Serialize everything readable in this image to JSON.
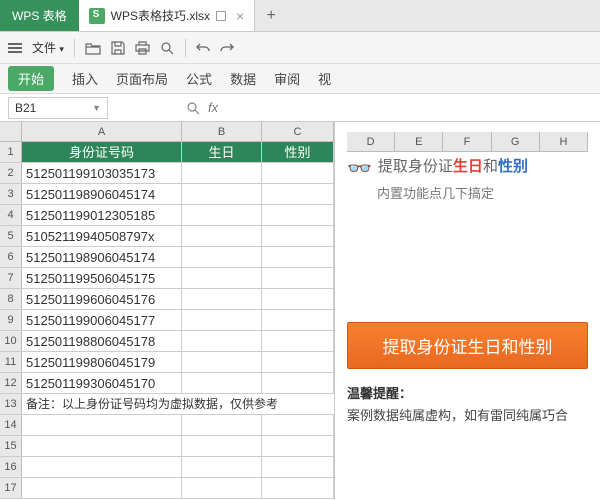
{
  "titlebar": {
    "app_name": "WPS 表格",
    "file_name": "WPS表格技巧.xlsx",
    "new_tab": "+"
  },
  "toolbar": {
    "file_menu": "文件"
  },
  "ribbon": {
    "start": "开始",
    "items": [
      "插入",
      "页面布局",
      "公式",
      "数据",
      "审阅",
      "视"
    ]
  },
  "formula": {
    "name_box": "B21",
    "fx": "fx"
  },
  "columns": [
    "A",
    "B",
    "C"
  ],
  "ext_columns": [
    "D",
    "E",
    "F",
    "G",
    "H"
  ],
  "headers": {
    "a": "身份证号码",
    "b": "生日",
    "c": "性别"
  },
  "rows": [
    "512501199103035173",
    "512501198906045174",
    "512501199012305185",
    "51052119940508797x",
    "512501198906045174",
    "512501199506045175",
    "512501199606045176",
    "512501199006045177",
    "512501198806045178",
    "512501199806045179",
    "512501199306045170"
  ],
  "note": "备注：以上身份证号码均为虚拟数据，仅供参考",
  "row_nums": [
    "1",
    "2",
    "3",
    "4",
    "5",
    "6",
    "7",
    "8",
    "9",
    "10",
    "11",
    "12",
    "13",
    "14",
    "15",
    "16",
    "17"
  ],
  "tip": {
    "t1": "提取身份证",
    "t2": "生日",
    "t3": "和",
    "t4": "性别",
    "sub": "内置功能点几下搞定"
  },
  "button": "提取身份证生日和性别",
  "warm": {
    "title": "温馨提醒：",
    "text": "案例数据纯属虚构，如有雷同纯属巧合"
  }
}
